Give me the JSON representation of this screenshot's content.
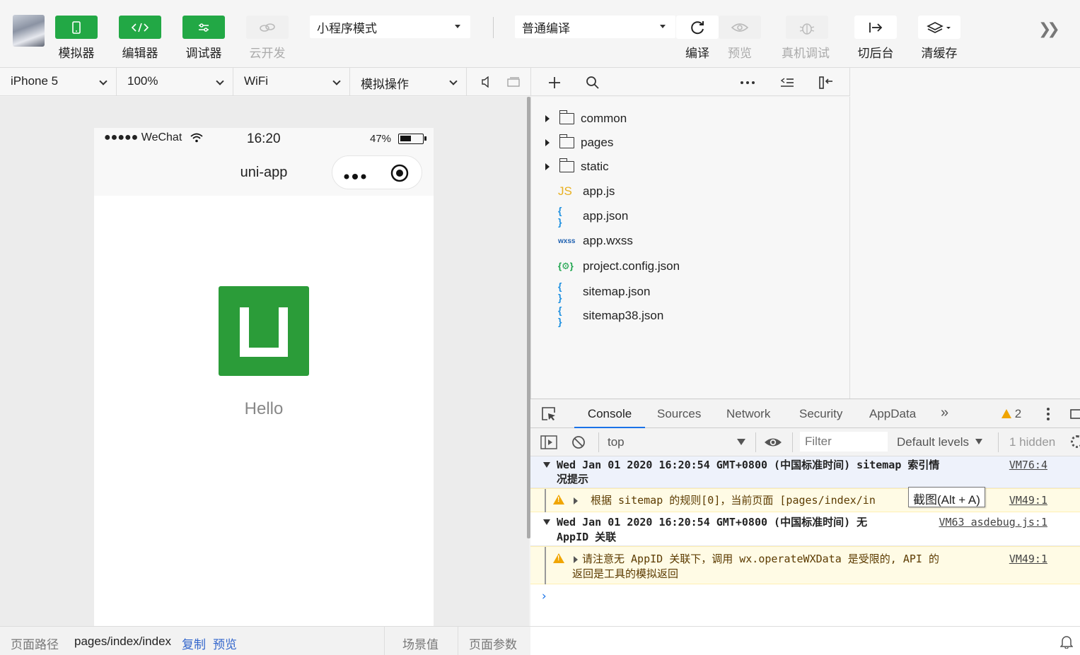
{
  "toolbar": {
    "simulator": "模拟器",
    "editor": "编辑器",
    "debugger": "调试器",
    "cloud": "云开发",
    "mode": "小程序模式",
    "compile_mode": "普通编译",
    "compile": "编译",
    "preview": "预览",
    "real_debug": "真机调试",
    "background": "切后台",
    "clear_cache": "清缓存"
  },
  "simbar": {
    "device": "iPhone 5",
    "zoom": "100%",
    "network": "WiFi",
    "operation": "模拟操作"
  },
  "phone": {
    "signal": "●●●●● WeChat",
    "time": "16:20",
    "battery": "47%",
    "nav_title": "uni-app",
    "hello": "Hello"
  },
  "files": [
    {
      "name": "common",
      "type": "folder"
    },
    {
      "name": "pages",
      "type": "folder"
    },
    {
      "name": "static",
      "type": "folder"
    },
    {
      "name": "app.js",
      "type": "js",
      "icon": "JS"
    },
    {
      "name": "app.json",
      "type": "json",
      "icon": "{ }"
    },
    {
      "name": "app.wxss",
      "type": "wxss",
      "icon": "wxss"
    },
    {
      "name": "project.config.json",
      "type": "config",
      "icon": "{⚙}"
    },
    {
      "name": "sitemap.json",
      "type": "json",
      "icon": "{ }"
    },
    {
      "name": "sitemap38.json",
      "type": "json",
      "icon": "{ }"
    }
  ],
  "devtools": {
    "tabs": [
      "Console",
      "Sources",
      "Network",
      "Security",
      "AppData"
    ],
    "warning_count": "2",
    "context": "top",
    "filter_placeholder": "Filter",
    "levels": "Default levels",
    "hidden": "1 hidden"
  },
  "console": {
    "g1_line1": "Wed Jan 01 2020 16:20:54 GMT+0800 (中国标准时间) sitemap 索引情",
    "g1_line2": "况提示",
    "g1_src": "VM76:4",
    "w1_text": "根据 sitemap 的规则[0]，当前页面 [pages/index/in",
    "w1_src": "VM49:1",
    "g2_line1": "Wed Jan 01 2020 16:20:54 GMT+0800 (中国标准时间) 无",
    "g2_line2": "AppID 关联",
    "g2_src": "VM63 asdebug.js:1",
    "w2_line1": "请注意无 AppID 关联下，调用 wx.operateWXData 是受限的, API 的",
    "w2_line2": "返回是工具的模拟返回",
    "w2_src": "VM49:1",
    "tooltip": "截图(Alt + A)"
  },
  "bottom": {
    "path_label": "页面路径",
    "path": "pages/index/index",
    "copy": "复制",
    "preview": "预览",
    "scene": "场景值",
    "params": "页面参数"
  },
  "colors": {
    "accent_green": "#22a845",
    "logo_green": "#2b9c39",
    "link_blue": "#3366cc",
    "warning": "#f0a500"
  }
}
